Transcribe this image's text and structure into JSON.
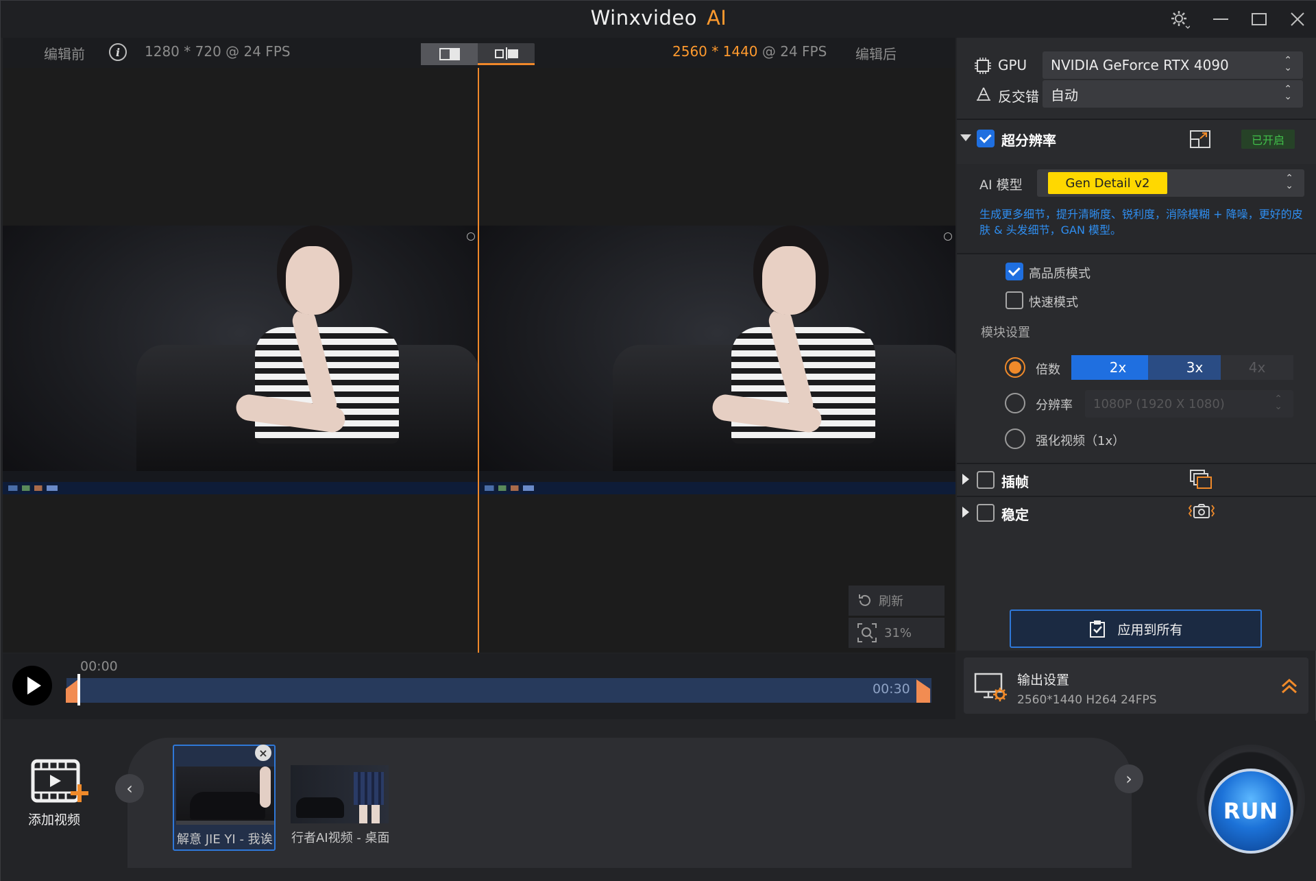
{
  "window": {
    "title": "Winxvideo",
    "title_ai": "AI"
  },
  "preview": {
    "before_label": "编辑前",
    "before_info": "1280 * 720 @ 24 FPS",
    "after_res": "2560 * 1440",
    "after_fps": "@ 24 FPS",
    "after_label": "编辑后",
    "refresh_label": "刷新",
    "zoom_label": "31%"
  },
  "timeline": {
    "start_time": "00:00",
    "end_time": "00:30"
  },
  "settings": {
    "gpu_label": "GPU",
    "gpu_value": "NVIDIA GeForce RTX 4090",
    "deinterlace_label": "反交错",
    "deinterlace_value": "自动",
    "super_res_label": "超分辨率",
    "super_res_badge": "已开启",
    "ai_model_label": "AI 模型",
    "ai_model_value": "Gen Detail v2",
    "ai_model_desc": "生成更多细节，提升清晰度、锐利度，消除模糊 + 降噪，更好的皮肤 & 头发细节，GAN 模型。",
    "high_quality_label": "高品质模式",
    "fast_mode_label": "快速模式",
    "module_settings_label": "模块设置",
    "scale_label": "倍数",
    "scale_options": [
      "2x",
      "3x",
      "4x"
    ],
    "resolution_label": "分辨率",
    "resolution_value": "1080P (1920 X 1080)",
    "enhance_label": "强化视频（1x）",
    "frame_interp_label": "插帧",
    "stabilize_label": "稳定",
    "apply_all_label": "应用到所有"
  },
  "output": {
    "title": "输出设置",
    "subtitle": "2560*1440  H264  24FPS"
  },
  "bottom": {
    "add_video_label": "添加视频",
    "thumbnails": [
      {
        "label": "解意 JIE YI - 我诶"
      },
      {
        "label": "行者AI视频 - 桌面"
      }
    ],
    "run_label": "RUN"
  },
  "colors": {
    "accent_orange": "#f0882a",
    "accent_blue": "#1f6fe0",
    "model_yellow": "#ffd800",
    "badge_green": "#41c04a"
  }
}
